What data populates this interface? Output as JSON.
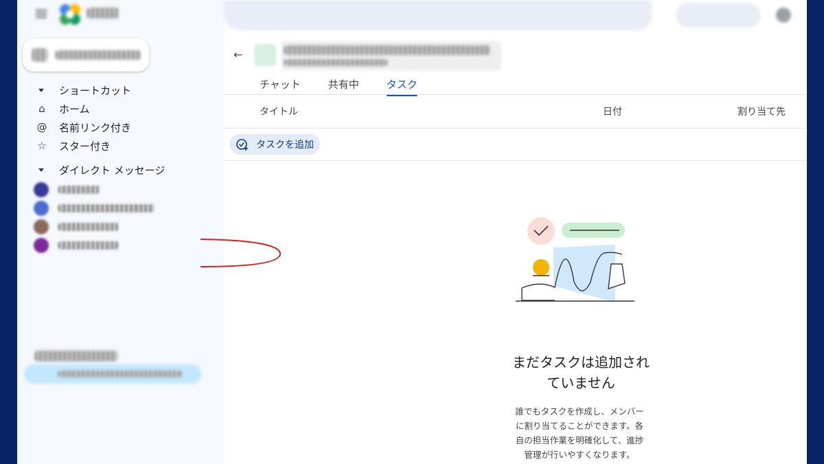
{
  "sidebar": {
    "sections": {
      "shortcuts": "ショートカット",
      "direct_messages": "ダイレクト メッセージ"
    },
    "shortcut_items": [
      {
        "label": "ホーム",
        "icon": "home-icon"
      },
      {
        "label": "名前リンク付き",
        "icon": "at-sign-icon"
      },
      {
        "label": "スター付き",
        "icon": "star-icon"
      }
    ],
    "dm_avatar_colors": [
      "#3a3a9a",
      "#4a6cd0",
      "#8a6a5a",
      "#7a2a9a"
    ]
  },
  "main": {
    "tabs": [
      {
        "label": "チャット",
        "active": false
      },
      {
        "label": "共有中",
        "active": false
      },
      {
        "label": "タスク",
        "active": true
      }
    ],
    "table_headers": {
      "title": "タイトル",
      "date": "日付",
      "assignee": "割り当て先"
    },
    "add_task_label": "タスクを追加",
    "empty_state": {
      "title_line1": "まだタスクは追加され",
      "title_line2": "ていません",
      "desc_line1": "誰でもタスクを作成し、メンバー",
      "desc_line2": "に割り当てることができます。各",
      "desc_line3": "自の担当作業を明確化して、進捗",
      "desc_line4": "管理が行いやすくなります。"
    }
  },
  "colors": {
    "accent": "#0b57d0",
    "sidebar_bg": "#f5f8fc",
    "frame": "#0a2468",
    "annotation": "#d9201e"
  }
}
